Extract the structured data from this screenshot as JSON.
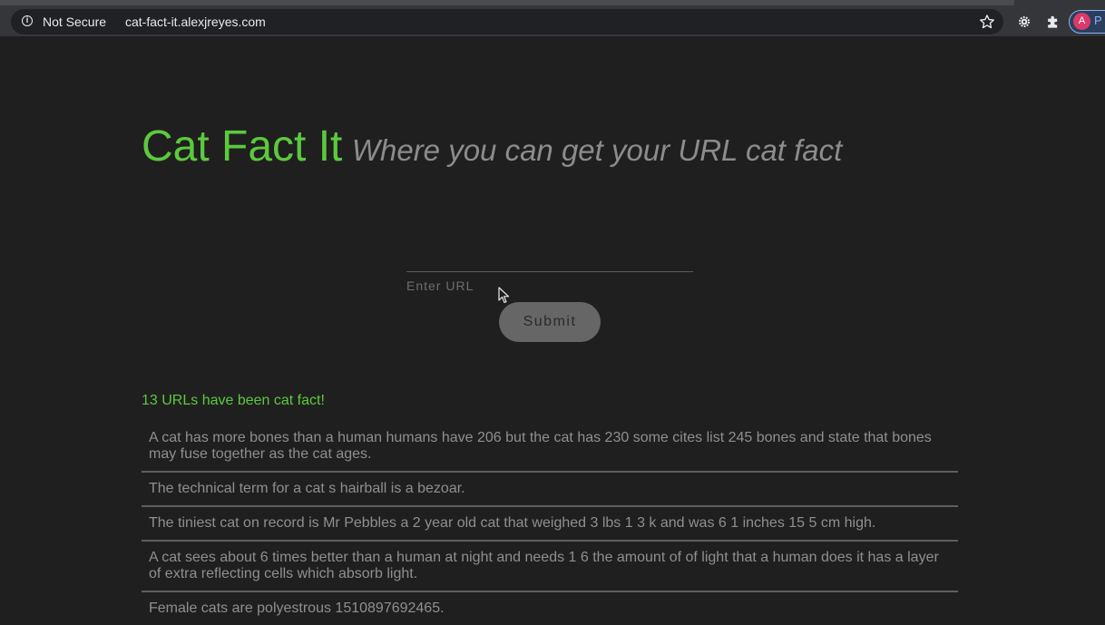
{
  "browser": {
    "security_label": "Not Secure",
    "url": "cat-fact-it.alexjreyes.com",
    "avatar_letter": "A",
    "avatar_extra": "P",
    "icons": [
      "info-icon",
      "star-icon",
      "gear-icon",
      "puzzle-icon"
    ]
  },
  "header": {
    "title": "Cat Fact It",
    "tagline": "Where you can get your URL cat fact"
  },
  "form": {
    "input_value": "",
    "input_label": "Enter URL",
    "submit_label": "Submit"
  },
  "stats": {
    "count_text": "13 URLs have been cat fact!"
  },
  "facts": [
    "A cat has more bones than a human humans have 206 but the cat has 230 some cites list 245 bones and state that bones may fuse together as the cat ages.",
    "The technical term for a cat s hairball is a bezoar.",
    "The tiniest cat on record is Mr Pebbles a 2 year old cat that weighed 3 lbs 1 3 k and was 6 1 inches 15 5 cm high.",
    "A cat sees about 6 times better than a human at night and needs 1 6 the amount of of light that a human does it has a layer of extra reflecting cells which absorb light.",
    "Female cats are polyestrous 1510897692465."
  ],
  "colors": {
    "background": "#1f1f1f",
    "accent_green": "#5cc93d",
    "muted_text": "#8f8f8f",
    "button": "#666666"
  }
}
